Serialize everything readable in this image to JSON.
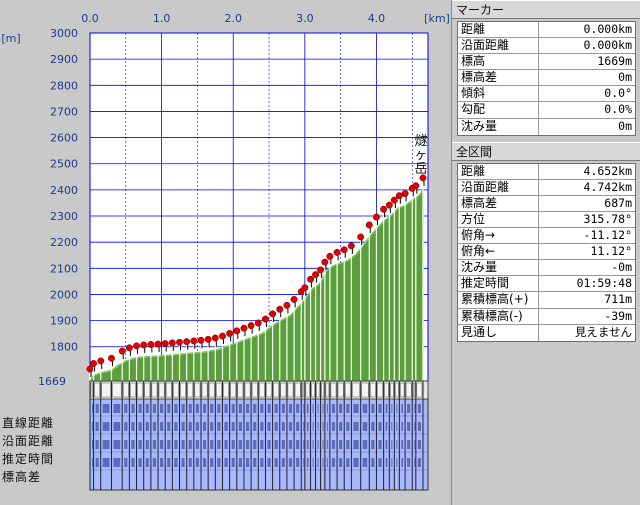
{
  "chart_data": {
    "type": "area",
    "title": "",
    "x_unit": "[km]",
    "y_unit": "[m]",
    "x_ticks": [
      "0.0",
      "1.0",
      "2.0",
      "3.0",
      "4.0"
    ],
    "y_ticks": [
      "3000",
      "2900",
      "2800",
      "2700",
      "2600",
      "2500",
      "2400",
      "2300",
      "2200",
      "2100",
      "2000",
      "1900",
      "1800"
    ],
    "y_base_label": "1669",
    "xlim": [
      0,
      4.72
    ],
    "ylim": [
      1669,
      3000
    ],
    "peak_label": "燧ヶ岳",
    "profile": {
      "x": [
        0.0,
        0.05,
        0.15,
        0.3,
        0.4,
        0.5,
        0.6,
        0.7,
        0.8,
        1.0,
        1.2,
        1.4,
        1.6,
        1.8,
        2.0,
        2.2,
        2.4,
        2.5,
        2.6,
        2.7,
        2.8,
        2.9,
        3.0,
        3.05,
        3.1,
        3.2,
        3.25,
        3.3,
        3.4,
        3.5,
        3.6,
        3.7,
        3.8,
        3.9,
        4.0,
        4.1,
        4.2,
        4.3,
        4.4,
        4.45,
        4.5,
        4.55,
        4.6,
        4.65
      ],
      "y": [
        1669,
        1690,
        1700,
        1710,
        1730,
        1745,
        1755,
        1760,
        1762,
        1765,
        1770,
        1775,
        1780,
        1790,
        1810,
        1830,
        1850,
        1870,
        1890,
        1905,
        1920,
        1950,
        1980,
        2000,
        2020,
        2040,
        2060,
        2090,
        2110,
        2120,
        2130,
        2150,
        2180,
        2220,
        2250,
        2280,
        2300,
        2330,
        2340,
        2350,
        2360,
        2370,
        2380,
        2400
      ]
    },
    "markers_x": [
      0.0,
      0.05,
      0.15,
      0.3,
      0.45,
      0.55,
      0.65,
      0.75,
      0.85,
      0.95,
      1.05,
      1.15,
      1.25,
      1.35,
      1.45,
      1.55,
      1.65,
      1.75,
      1.85,
      1.95,
      2.05,
      2.15,
      2.25,
      2.35,
      2.45,
      2.55,
      2.65,
      2.75,
      2.85,
      2.95,
      3.0,
      3.08,
      3.15,
      3.22,
      3.28,
      3.35,
      3.45,
      3.55,
      3.65,
      3.78,
      3.9,
      4.0,
      4.1,
      4.18,
      4.25,
      4.32,
      4.4,
      4.5,
      4.55,
      4.65
    ],
    "table_rows": [
      "直線距離",
      "沿面距離",
      "推定時間",
      "標高差"
    ]
  },
  "colors": {
    "plot_bg": "#ffffff",
    "grid": "#0000ff",
    "fill": "#5aa03a",
    "fill_light": "#8cc66a",
    "marker": "#e00000",
    "table_bg": "#a8b8ff"
  },
  "panel": {
    "marker": {
      "title": "マーカー",
      "rows": [
        {
          "key": "距離",
          "value": "0.000km"
        },
        {
          "key": "沿面距離",
          "value": "0.000km"
        },
        {
          "key": "標高",
          "value": "1669m"
        },
        {
          "key": "標高差",
          "value": "0m"
        },
        {
          "key": "傾斜",
          "value": "0.0°"
        },
        {
          "key": "勾配",
          "value": "0.0%"
        },
        {
          "key": "沈み量",
          "value": "0m"
        }
      ]
    },
    "section": {
      "title": "全区間",
      "rows": [
        {
          "key": "距離",
          "value": "4.652km"
        },
        {
          "key": "沿面距離",
          "value": "4.742km"
        },
        {
          "key": "標高差",
          "value": "687m"
        },
        {
          "key": "方位",
          "value": "315.78°"
        },
        {
          "key": "俯角→",
          "value": "-11.12°"
        },
        {
          "key": "俯角←",
          "value": "11.12°"
        },
        {
          "key": "沈み量",
          "value": "-0m"
        },
        {
          "key": "推定時間",
          "value": "01:59:48"
        },
        {
          "key": "累積標高(+)",
          "value": "711m"
        },
        {
          "key": "累積標高(-)",
          "value": "-39m"
        },
        {
          "key": "見通し",
          "value": "見えません"
        }
      ]
    }
  }
}
